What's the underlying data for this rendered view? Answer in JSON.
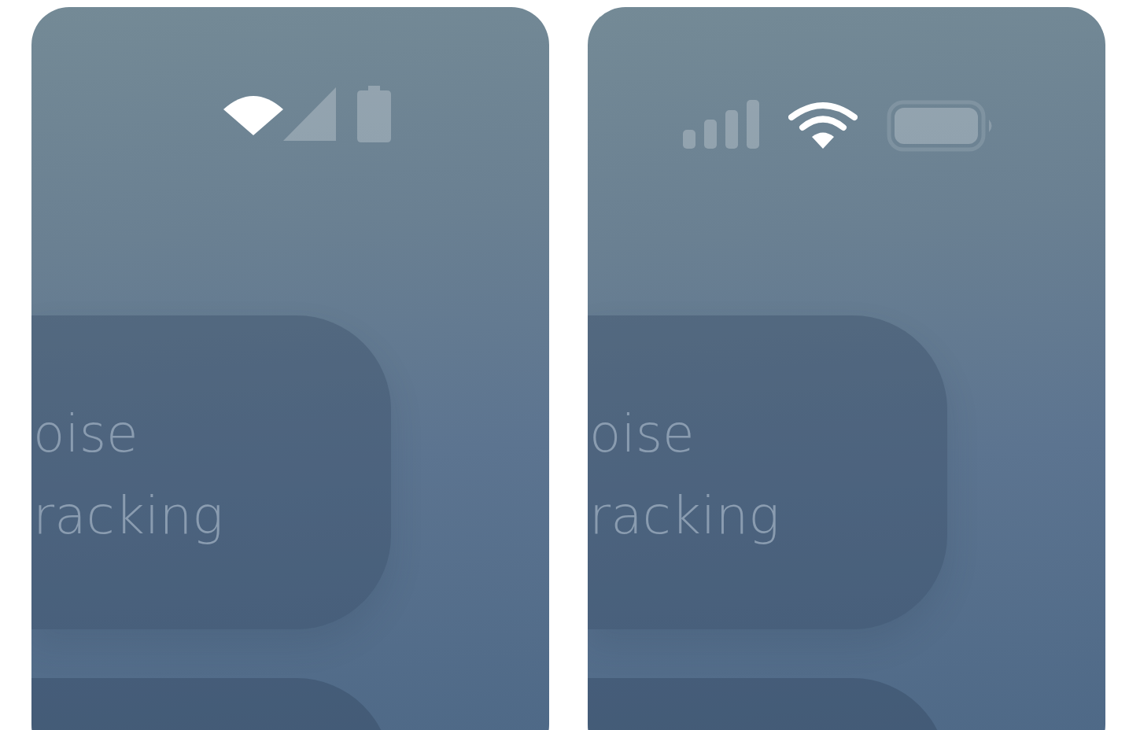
{
  "phones": [
    {
      "kind": "android",
      "card": {
        "lines": [
          "oise",
          "racking"
        ]
      }
    },
    {
      "kind": "ios",
      "card": {
        "lines": [
          "oise",
          "racking"
        ]
      }
    }
  ]
}
